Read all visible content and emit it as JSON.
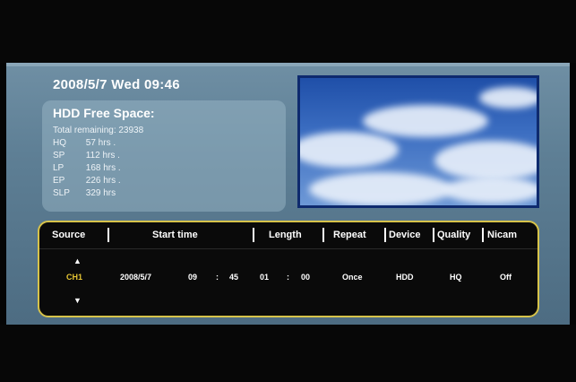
{
  "osd": {
    "datetime": "2008/5/7 Wed 09:46",
    "hdd": {
      "title": "HDD Free Space:",
      "total": "Total remaining: 23938",
      "modes": [
        {
          "mode": "HQ",
          "time": "57 hrs ."
        },
        {
          "mode": "SP",
          "time": "112 hrs ."
        },
        {
          "mode": "LP",
          "time": "168 hrs ."
        },
        {
          "mode": "EP",
          "time": "226 hrs ."
        },
        {
          "mode": "SLP",
          "time": "329 hrs"
        }
      ]
    }
  },
  "schedule": {
    "headers": {
      "source": "Source",
      "start_time": "Start time",
      "length": "Length",
      "repeat": "Repeat",
      "device": "Device",
      "quality": "Quality",
      "nicam": "Nicam"
    },
    "row": {
      "source": "CH1",
      "date": "2008/5/7",
      "start_hour": "09",
      "start_colon": ":",
      "start_minute": "45",
      "length_hour": "01",
      "length_colon": ":",
      "length_minute": "00",
      "repeat": "Once",
      "device": "HDD",
      "quality": "HQ",
      "nicam": "Off"
    },
    "up_arrow": "▲",
    "down_arrow": "▼"
  },
  "colors": {
    "accent_border": "#d7c34a",
    "selected_text": "#e6c533",
    "panel_bg": "#5e7f95"
  }
}
